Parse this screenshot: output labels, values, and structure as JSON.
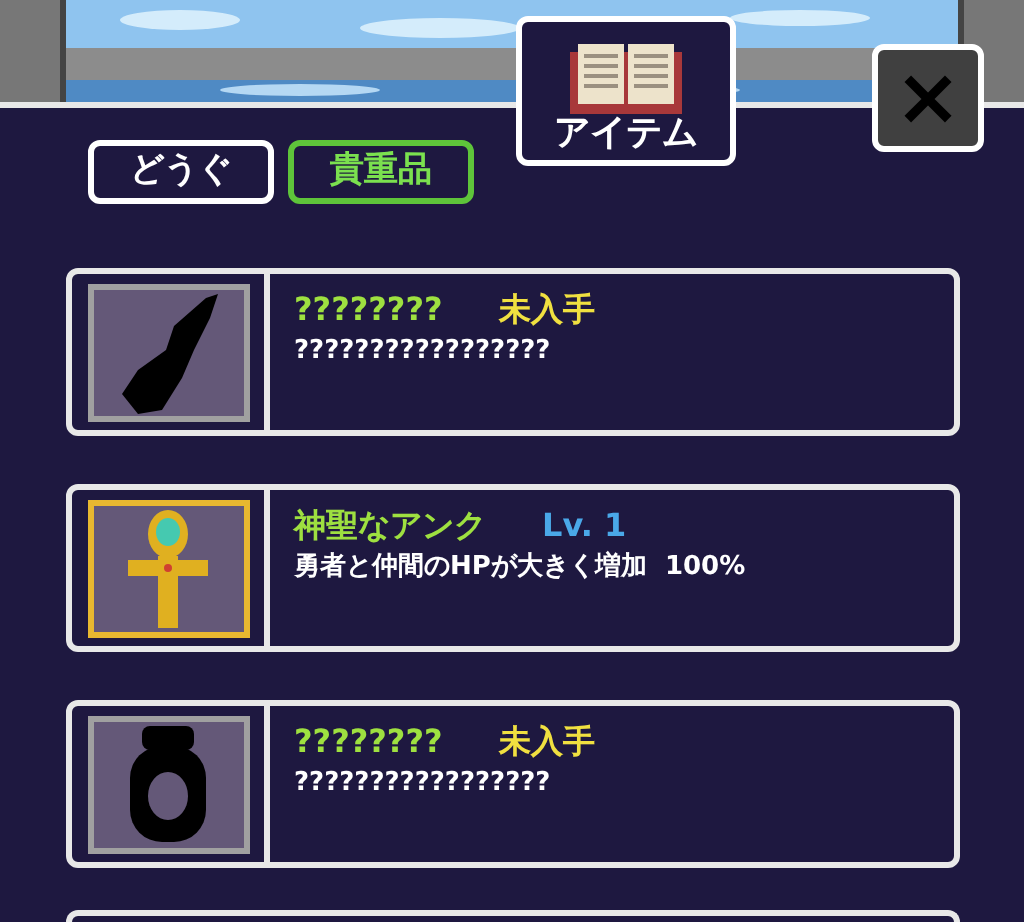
{
  "header": {
    "title": "アイテム"
  },
  "close_button": {
    "label": "×"
  },
  "tabs": [
    {
      "label": "どうぐ",
      "selected": false
    },
    {
      "label": "貴重品",
      "selected": true
    }
  ],
  "items": [
    {
      "kind": "locked",
      "name": "????????",
      "status": "未入手",
      "description": "?????????????????"
    },
    {
      "kind": "owned",
      "name": "神聖なアンク",
      "status": "Lv. 1",
      "description": "勇者と仲間のHPが大きく増加  100%"
    },
    {
      "kind": "locked",
      "name": "????????",
      "status": "未入手",
      "description": "?????????????????"
    }
  ]
}
